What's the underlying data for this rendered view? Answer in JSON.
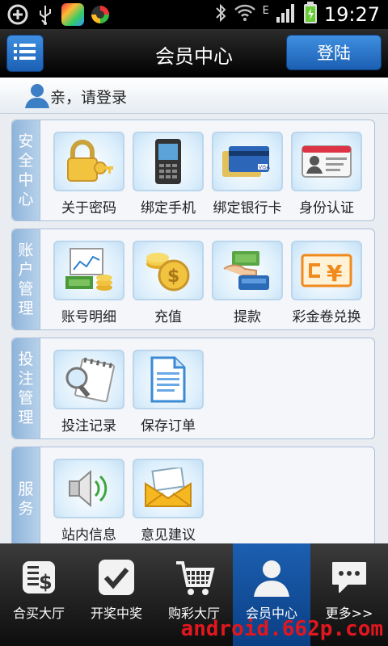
{
  "status_bar": {
    "time": "19:27",
    "network_type": "E",
    "icons": [
      "add-circle-icon",
      "usb-icon",
      "app-icon",
      "app-icon",
      "bluetooth-icon",
      "wifi-icon",
      "signal-icon",
      "battery-icon"
    ]
  },
  "header": {
    "title": "会员中心",
    "login_label": "登陆",
    "menu_icon": "list-menu-icon"
  },
  "user_bar": {
    "prompt": "亲，请登录",
    "icon": "user-icon"
  },
  "sections": [
    {
      "label_chars": [
        "安",
        "全",
        "中",
        "心"
      ],
      "items": [
        {
          "label": "关于密码",
          "icon": "padlock-key-icon"
        },
        {
          "label": "绑定手机",
          "icon": "mobile-phone-icon"
        },
        {
          "label": "绑定银行卡",
          "icon": "bank-cards-icon"
        },
        {
          "label": "身份认证",
          "icon": "id-card-icon"
        }
      ]
    },
    {
      "label_chars": [
        "账",
        "户",
        "管",
        "理"
      ],
      "items": [
        {
          "label": "账号明细",
          "icon": "account-chart-icon"
        },
        {
          "label": "充值",
          "icon": "coins-icon"
        },
        {
          "label": "提款",
          "icon": "withdraw-money-icon"
        },
        {
          "label": "彩金卷兑换",
          "icon": "yuan-coupon-icon"
        }
      ]
    },
    {
      "label_chars": [
        "投",
        "注",
        "管",
        "理"
      ],
      "items": [
        {
          "label": "投注记录",
          "icon": "notebook-search-icon"
        },
        {
          "label": "保存订单",
          "icon": "document-icon"
        }
      ]
    },
    {
      "label_chars": [
        "服",
        "务"
      ],
      "items": [
        {
          "label": "站内信息",
          "icon": "speaker-icon"
        },
        {
          "label": "意见建议",
          "icon": "envelope-icon"
        }
      ]
    }
  ],
  "tabs": [
    {
      "label": "合买大厅",
      "icon": "dollar-document-icon",
      "active": false
    },
    {
      "label": "开奖中奖",
      "icon": "checkmark-icon",
      "active": false
    },
    {
      "label": "购彩大厅",
      "icon": "shopping-cart-icon",
      "active": false
    },
    {
      "label": "会员中心",
      "icon": "member-icon",
      "active": true
    },
    {
      "label": "更多>>",
      "icon": "chat-bubble-icon",
      "active": false
    }
  ],
  "watermark": "android.662p.com",
  "colors": {
    "accent": "#1b5fb3",
    "section_label": "#8eb4da",
    "watermark": "#e1171f"
  }
}
